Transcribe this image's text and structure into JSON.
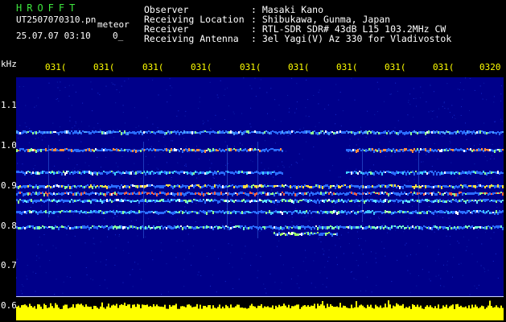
{
  "header": {
    "app_title": "HROFFT",
    "file_name": "UT2507070310.pn",
    "file_suffix": "meteor",
    "date_time": "25.07.07 03:10",
    "time_suffix": "0_"
  },
  "info": {
    "observer_label": "Observer",
    "observer_value": ": Masaki Kano",
    "location_label": "Receiving Location",
    "location_value": ": Shibukawa, Gunma, Japan",
    "receiver_label": "Receiver",
    "receiver_value": ": RTL-SDR SDR# 43dB L15 103.2MHz CW",
    "antenna_label": "Receiving Antenna",
    "antenna_value": ": 3el Yagi(V) Az 330 for Vladivostok"
  },
  "axis": {
    "unit": "kHz",
    "time_ticks": [
      "031(",
      "031(",
      "031(",
      "031(",
      "031(",
      "031(",
      "031(",
      "031(",
      "031(",
      "0320"
    ],
    "freq_ticks": [
      "1.1",
      "1.0",
      "0.9",
      "0.8",
      "0.7",
      "0.6"
    ]
  },
  "colors": {
    "title_green": "#3ee63e",
    "text_white": "#ffffff",
    "tick_yellow": "#ffff00",
    "background": "#000000",
    "plot_background": "#00008a",
    "signal_level": "#ffff00"
  }
}
